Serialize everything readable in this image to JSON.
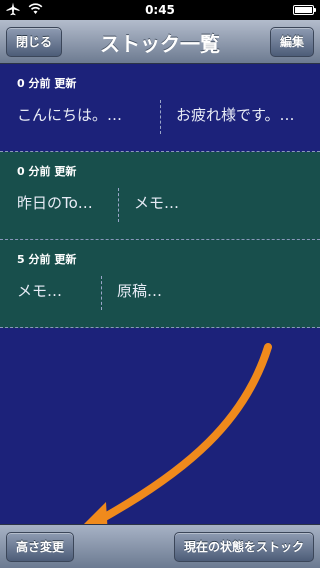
{
  "status_bar": {
    "time": "0:45",
    "airplane_icon": "airplane-icon",
    "wifi_icon": "wifi-icon",
    "battery_icon": "battery-icon"
  },
  "nav": {
    "title": "ストック一覧",
    "close_label": "閉じる",
    "edit_label": "編集"
  },
  "colors": {
    "background": "#1c227a",
    "card_blue": "#1c227a",
    "card_green": "#184f4c",
    "arrow": "#f08a1c"
  },
  "cards": [
    {
      "header": "0 分前 更新",
      "cells": [
        "こんにちは。…",
        "お疲れ様です。…"
      ]
    },
    {
      "header": "0 分前 更新",
      "cells": [
        "昨日のTo…",
        "メモ…"
      ]
    },
    {
      "header": "5 分前 更新",
      "cells": [
        "メモ…",
        "原稿…"
      ]
    }
  ],
  "toolbar": {
    "height_label": "高さ変更",
    "stock_label": "現在の状態をストック"
  }
}
